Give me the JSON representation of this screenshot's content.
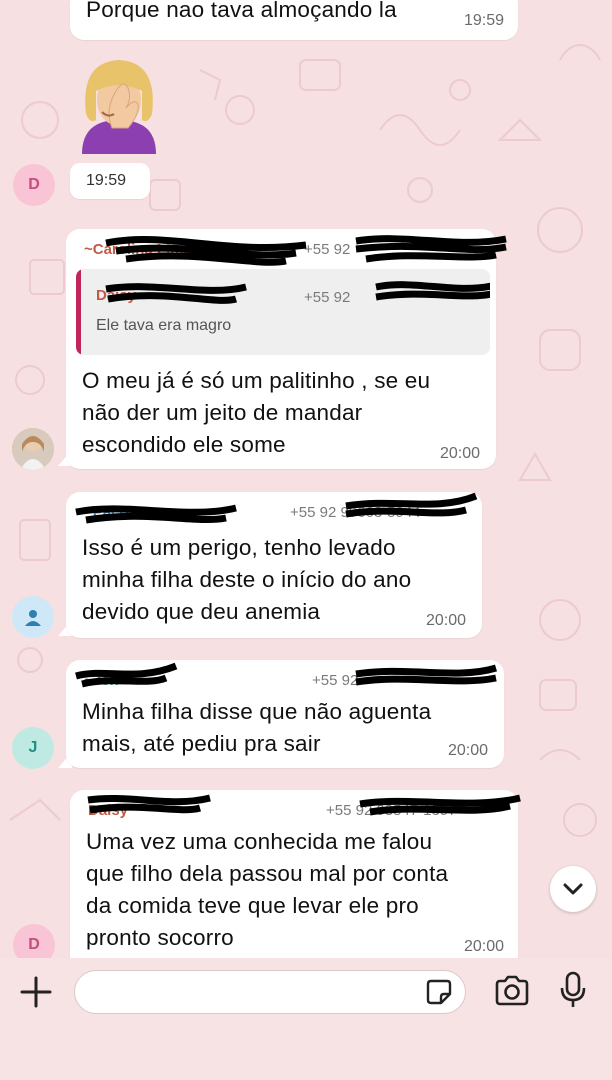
{
  "messages": [
    {
      "text": "Porque nao tava almoçando la",
      "time": "19:59"
    },
    {
      "sticker": "facepalm-emoji",
      "time": "19:59",
      "avatar_letter": "D"
    },
    {
      "sender": "~Carolina Lima",
      "phone": "+55 92",
      "quoted_sender": "Daisy",
      "quoted_phone": "+55 92",
      "quoted_text": "Ele tava era magro",
      "lines": [
        "O meu já é só um palitinho , se eu",
        "não der um jeito de mandar",
        "escondido ele some"
      ],
      "time": "20:00"
    },
    {
      "sender": "~Paco",
      "phone": "+55 92 99663-5944",
      "lines": [
        "Isso é um perigo, tenho levado",
        "minha filha deste o início do ano",
        "devido que deu anemia"
      ],
      "time": "20:00"
    },
    {
      "sender": "~Jen",
      "phone": "+55 92",
      "lines": [
        "Minha filha disse que não aguenta",
        "mais, até pediu pra sair"
      ],
      "time": "20:00",
      "avatar_letter": "J"
    },
    {
      "sender": "Daisy",
      "phone": "+55 92 98547-1397",
      "lines": [
        "Uma vez uma conhecida me falou",
        "que filho dela passou mal por conta",
        "da comida teve que levar ele pro",
        "pronto socorro"
      ],
      "time": "20:00",
      "avatar_letter": "D"
    }
  ],
  "icons": {
    "scroll": "chevron-down-icon",
    "add": "plus-icon",
    "sticker": "sticker-icon",
    "camera": "camera-icon",
    "mic": "microphone-icon"
  },
  "colors": {
    "background": "#f6e0e1",
    "bubble": "#ffffff",
    "quote_bar": "#c0265a"
  }
}
